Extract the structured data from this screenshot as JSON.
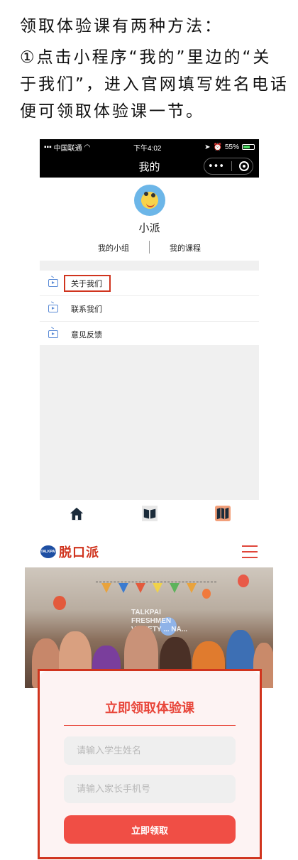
{
  "instructions": {
    "line1": "领取体验课有两种方法：",
    "line2": "①点击小程序“我的”里边的“关于我们”，进入官网填写姓名电话便可领取体验课一节。"
  },
  "phone": {
    "status": {
      "carrier": "中国联通",
      "time": "下午4:02",
      "battery": "55%"
    },
    "nav_title": "我的",
    "capsule_more": "•••",
    "user_name": "小派",
    "tabs": [
      "我的小组",
      "我的课程"
    ],
    "menu": [
      {
        "label": "关于我们",
        "icon": "tv-icon",
        "highlighted": true
      },
      {
        "label": "联系我们",
        "icon": "tv-icon"
      },
      {
        "label": "意见反馈",
        "icon": "tv-icon"
      }
    ],
    "tabbar_icons": [
      "home-icon",
      "book-icon",
      "map-icon"
    ]
  },
  "website": {
    "logo_badge": "TALKPAI",
    "logo_text": "脱口派",
    "photo_sign": "TALKPAI FRESHMEN VARIETY ... NA...",
    "form": {
      "title": "立即领取体验课",
      "name_placeholder": "请输入学生姓名",
      "phone_placeholder": "请输入家长手机号",
      "submit_label": "立即领取"
    }
  },
  "colors": {
    "highlight_border": "#d0341e",
    "brand_red": "#e8463a",
    "button_red": "#f04e45",
    "icon_blue": "#5b8bd6"
  }
}
